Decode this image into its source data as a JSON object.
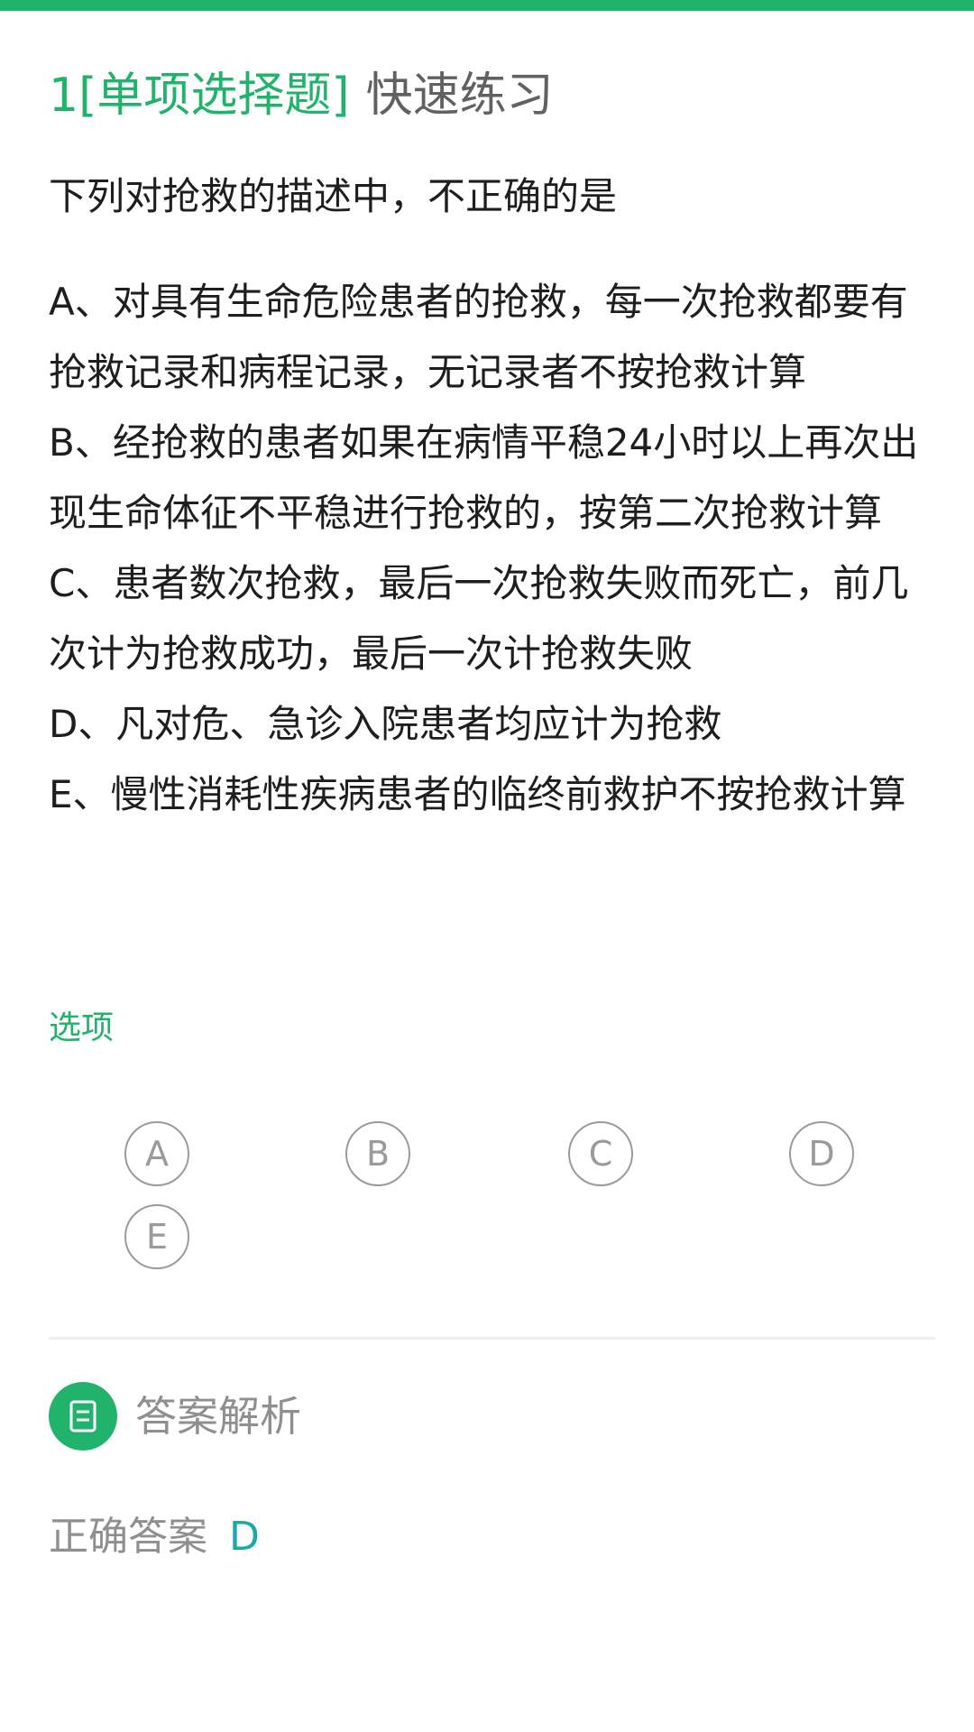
{
  "header": {
    "number": "1",
    "type": "[单项选择题]",
    "mode": "快速练习"
  },
  "question": {
    "stem": "下列对抢救的描述中，不正确的是",
    "options": [
      "A、对具有生命危险患者的抢救，每一次抢救都要有抢救记录和病程记录，无记录者不按抢救计算",
      "B、经抢救的患者如果在病情平稳24小时以上再次出现生命体征不平稳进行抢救的，按第二次抢救计算",
      "C、患者数次抢救，最后一次抢救失败而死亡，前几次计为抢救成功，最后一次计抢救失败",
      "D、凡对危、急诊入院患者均应计为抢救",
      "E、慢性消耗性疾病患者的临终前救护不按抢救计算"
    ]
  },
  "choices": {
    "label": "选项",
    "items": [
      "A",
      "B",
      "C",
      "D",
      "E"
    ]
  },
  "analysis": {
    "title": "答案解析",
    "icon": "document-icon",
    "answer_label": "正确答案",
    "answer_value": "D"
  },
  "colors": {
    "accent": "#21b26b",
    "answer": "#1aa8a8",
    "muted": "#8f8f8f"
  }
}
